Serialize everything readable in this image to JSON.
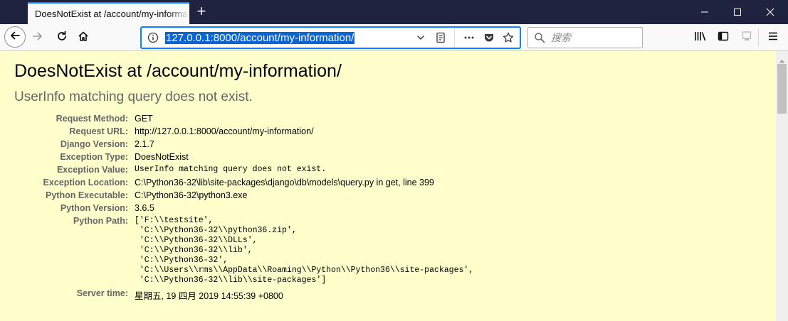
{
  "tab": {
    "title": "DoesNotExist at /account/my-information/"
  },
  "toolbar": {
    "url": "127.0.0.1:8000/account/my-information/",
    "search_placeholder": "搜索"
  },
  "page": {
    "title": "DoesNotExist at /account/my-information/",
    "subtitle": "UserInfo matching query does not exist.",
    "meta": [
      {
        "label": "Request Method:",
        "value": "GET"
      },
      {
        "label": "Request URL:",
        "value": "http://127.0.0.1:8000/account/my-information/"
      },
      {
        "label": "Django Version:",
        "value": "2.1.7"
      },
      {
        "label": "Exception Type:",
        "value": "DoesNotExist"
      },
      {
        "label": "Exception Value:",
        "value": "UserInfo matching query does not exist."
      },
      {
        "label": "Exception Location:",
        "value": "C:\\Python36-32\\lib\\site-packages\\django\\db\\models\\query.py in get, line 399"
      },
      {
        "label": "Python Executable:",
        "value": "C:\\Python36-32\\python3.exe"
      },
      {
        "label": "Python Version:",
        "value": "3.6.5"
      },
      {
        "label": "Python Path:",
        "value": "['F:\\\\testsite',\n 'C:\\\\Python36-32\\\\python36.zip',\n 'C:\\\\Python36-32\\\\DLLs',\n 'C:\\\\Python36-32\\\\lib',\n 'C:\\\\Python36-32',\n 'C:\\\\Users\\\\rms\\\\AppData\\\\Roaming\\\\Python\\\\Python36\\\\site-packages',\n 'C:\\\\Python36-32\\\\lib\\\\site-packages']"
      },
      {
        "label": "Server time:",
        "value": "星期五, 19 四月 2019 14:55:39 +0800"
      }
    ]
  },
  "colors": {
    "accent": "#0a84ff",
    "page_background": "#ffffcc",
    "titlebar": "#1f2340"
  },
  "icons": [
    "new-tab-icon",
    "minimize-icon",
    "maximize-icon",
    "close-icon",
    "back-arrow-icon",
    "forward-arrow-icon",
    "reload-icon",
    "home-icon",
    "info-icon",
    "chevron-down-icon",
    "reader-view-icon",
    "more-actions-icon",
    "pocket-icon",
    "bookmark-star-icon",
    "search-icon",
    "library-icon",
    "sidebar-icon",
    "screenshot-icon",
    "hamburger-menu-icon"
  ]
}
